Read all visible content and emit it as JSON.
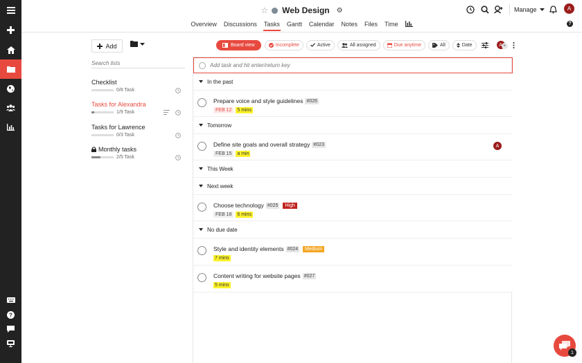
{
  "header": {
    "project_title": "Web Design",
    "tabs": [
      "Overview",
      "Discussions",
      "Tasks",
      "Gantt",
      "Calendar",
      "Notes",
      "Files",
      "Time"
    ],
    "active_tab": "Tasks",
    "manage_label": "Manage",
    "avatar_initial": "A"
  },
  "lists": {
    "add_label": "Add",
    "search_placeholder": "Search lists",
    "items": [
      {
        "name": "Checklist",
        "progress": "0/8 Task",
        "fraction": 0.0
      },
      {
        "name": "Tasks for Alexandra",
        "progress": "1/9 Task",
        "fraction": 0.11
      },
      {
        "name": "Tasks for Lawrence",
        "progress": "0/3 Task",
        "fraction": 0.0
      },
      {
        "name": "Monthly tasks",
        "progress": "2/5 Task",
        "fraction": 0.4
      }
    ]
  },
  "toolbar": {
    "board_view": "Board view",
    "incomplete": "Incomplete",
    "active": "Active",
    "all_assigned": "All assigned",
    "due_anytime": "Due anytime",
    "all": "All",
    "date": "Date",
    "assignee_initial": "A"
  },
  "add_task_placeholder": "Add task and hit enter/return key",
  "groups": {
    "past": "In the past",
    "tomorrow": "Tomorrow",
    "this_week": "This Week",
    "next_week": "Next week",
    "no_due": "No due date"
  },
  "tasks": [
    {
      "name": "Prepare voice and style guidelines",
      "id": "#026",
      "date": "FEB 12",
      "estimate": "5 mins"
    },
    {
      "name": "Define site goals and overall strategy",
      "id": "#023",
      "date": "FEB 15",
      "estimate": "a min",
      "assignee": "A"
    },
    {
      "name": "Choose technology",
      "id": "#025",
      "priority": "High",
      "date": "FEB 18",
      "estimate": "6 mins"
    },
    {
      "name": "Style and identity elements",
      "id": "#024",
      "priority": "Medium",
      "estimate": "7 mins"
    },
    {
      "name": "Content writing for website pages",
      "id": "#027",
      "estimate": "5 mins"
    }
  ],
  "fab_badge": "1",
  "colors": {
    "accent": "#e8493f",
    "rail": "#222222",
    "estimate": "#fcf12a",
    "high": "#c0241f",
    "medium": "#f5a623"
  }
}
